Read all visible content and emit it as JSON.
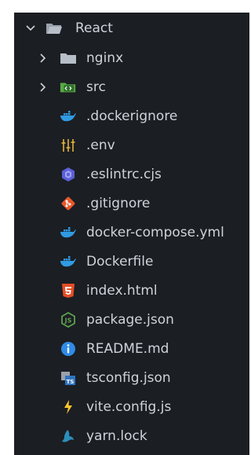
{
  "explorer": {
    "root": {
      "label": "React"
    },
    "folders": [
      {
        "label": "nginx",
        "icon": "folder-icon"
      },
      {
        "label": "src",
        "icon": "code-folder-icon"
      }
    ],
    "files": [
      {
        "label": ".dockerignore",
        "icon": "docker-icon"
      },
      {
        "label": ".env",
        "icon": "env-sliders-icon"
      },
      {
        "label": ".eslintrc.cjs",
        "icon": "eslint-icon"
      },
      {
        "label": ".gitignore",
        "icon": "git-icon"
      },
      {
        "label": "docker-compose.yml",
        "icon": "docker-icon"
      },
      {
        "label": "Dockerfile",
        "icon": "docker-icon"
      },
      {
        "label": "index.html",
        "icon": "html5-icon"
      },
      {
        "label": "package.json",
        "icon": "nodejs-icon"
      },
      {
        "label": "README.md",
        "icon": "info-icon"
      },
      {
        "label": "tsconfig.json",
        "icon": "typescript-icon"
      },
      {
        "label": "vite.config.js",
        "icon": "vite-bolt-icon"
      },
      {
        "label": "yarn.lock",
        "icon": "yarn-icon"
      }
    ]
  },
  "colors": {
    "background": "#1b1e23",
    "text": "#cfd3da",
    "docker": "#2f9be3",
    "html5": "#e44d26",
    "node": "#5fa04e",
    "git": "#e8572c",
    "eslint": "#5b5fd6",
    "info": "#2f8be6",
    "vite": "#ffc72c",
    "yarn": "#2c8ebb"
  }
}
